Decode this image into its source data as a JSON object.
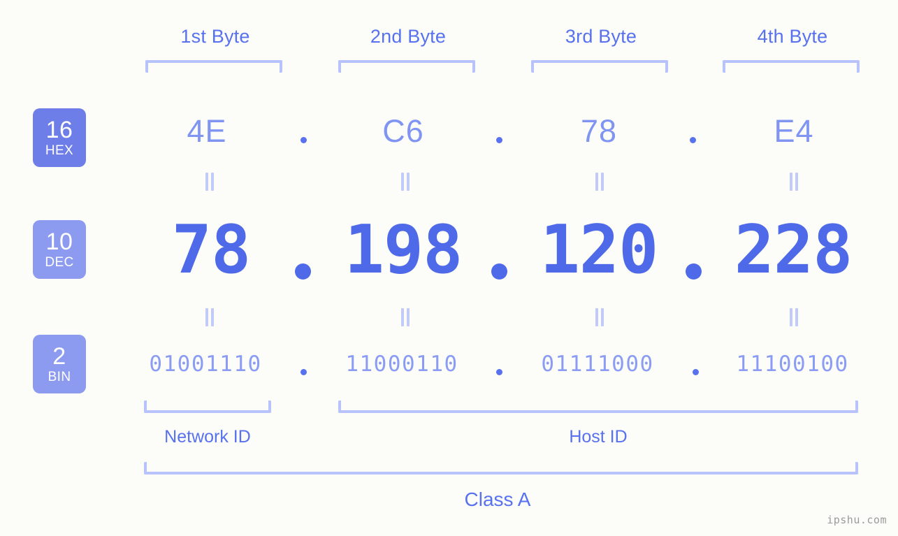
{
  "background_color": "#fcfdf8",
  "accent_colors": {
    "label_blue": "#5871ee",
    "bracket_blue": "#b9c3fb",
    "hex_value_blue": "#8094f2",
    "dec_value_blue": "#4f6ae8",
    "bin_value_blue": "#8a9cf3",
    "badge_hex": "#6e7ee8",
    "badge_dec": "#8c9bf0",
    "badge_bin": "#8c9bf0",
    "equals_marker": "#c2caf8",
    "watermark": "#9a9a9a"
  },
  "byte_headers": [
    {
      "label": "1st Byte"
    },
    {
      "label": "2nd Byte"
    },
    {
      "label": "3rd Byte"
    },
    {
      "label": "4th Byte"
    }
  ],
  "radix_badges": [
    {
      "number": "16",
      "name": "HEX"
    },
    {
      "number": "10",
      "name": "DEC"
    },
    {
      "number": "2",
      "name": "BIN"
    }
  ],
  "rows": {
    "hex": {
      "separator": ".",
      "values": [
        "4E",
        "C6",
        "78",
        "E4"
      ]
    },
    "dec": {
      "separator": ".",
      "values": [
        "78",
        "198",
        "120",
        "228"
      ]
    },
    "bin": {
      "separator": ".",
      "values": [
        "01001110",
        "11000110",
        "01111000",
        "11100100"
      ]
    }
  },
  "equality_marker": "=",
  "sections": [
    {
      "label": "Network ID",
      "bytes": "1"
    },
    {
      "label": "Host ID",
      "bytes": "2-4"
    }
  ],
  "class_label": "Class A",
  "watermark": "ipshu.com"
}
